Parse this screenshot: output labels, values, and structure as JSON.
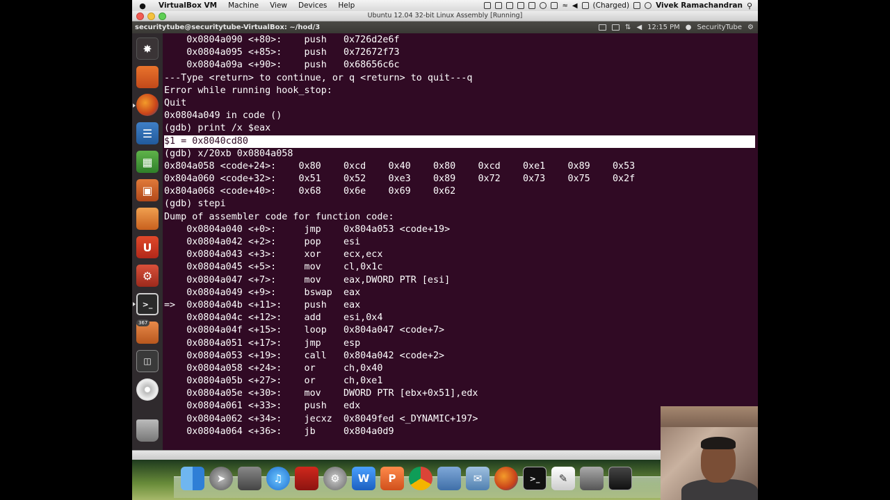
{
  "mac_menubar": {
    "apple": "",
    "app_name": "VirtualBox VM",
    "menus": [
      "Machine",
      "View",
      "Devices",
      "Help"
    ],
    "battery": "(Charged)",
    "user": "Vivek Ramachandran"
  },
  "vm_window": {
    "title": "Ubuntu 12.04 32-bit Linux Assembly [Running]"
  },
  "ubuntu_panel": {
    "window_title": "securitytube@securitytube-VirtualBox: ~/hod/3",
    "clock": "12:15 PM",
    "user": "SecurityTube"
  },
  "launcher": {
    "badge": "367"
  },
  "terminal": {
    "lines": [
      "    0x0804a090 <+80>:    push   0x726d2e6f",
      "    0x0804a095 <+85>:    push   0x72672f73",
      "    0x0804a09a <+90>:    push   0x68656c6c",
      "---Type <return> to continue, or q <return> to quit---q",
      "Error while running hook_stop:",
      "Quit",
      "0x0804a049 in code ()",
      "(gdb) print /x $eax",
      "$1 = 0x8040cd80",
      "(gdb) x/20xb 0x0804a058",
      "0x804a058 <code+24>:    0x80    0xcd    0x40    0x80    0xcd    0xe1    0x89    0x53",
      "0x804a060 <code+32>:    0x51    0x52    0xe3    0x89    0x72    0x73    0x75    0x2f",
      "0x804a068 <code+40>:    0x68    0x6e    0x69    0x62",
      "(gdb) stepi",
      "Dump of assembler code for function code:",
      "    0x0804a040 <+0>:     jmp    0x804a053 <code+19>",
      "    0x0804a042 <+2>:     pop    esi",
      "    0x0804a043 <+3>:     xor    ecx,ecx",
      "    0x0804a045 <+5>:     mov    cl,0x1c",
      "    0x0804a047 <+7>:     mov    eax,DWORD PTR [esi]",
      "    0x0804a049 <+9>:     bswap  eax",
      "=>  0x0804a04b <+11>:    push   eax",
      "    0x0804a04c <+12>:    add    esi,0x4",
      "    0x0804a04f <+15>:    loop   0x804a047 <code+7>",
      "    0x0804a051 <+17>:    jmp    esp",
      "    0x0804a053 <+19>:    call   0x804a042 <code+2>",
      "    0x0804a058 <+24>:    or     ch,0x40",
      "    0x0804a05b <+27>:    or     ch,0xe1",
      "    0x0804a05e <+30>:    mov    DWORD PTR [ebx+0x51],edx",
      "    0x0804a061 <+33>:    push   edx",
      "    0x0804a062 <+34>:    jecxz  0x8049fed <_DYNAMIC+197>",
      "    0x0804a064 <+36>:    jb     0x804a0d9"
    ],
    "highlighted_line": 8,
    "background": "#300a24"
  },
  "colors": {
    "terminal_bg": "#300a24",
    "terminal_fg": "#ffffff",
    "launcher_bg": "#2f2a2d",
    "panel_bg": "#3c3b37"
  },
  "icons": {
    "launcher": [
      "dash-icon",
      "files-icon",
      "firefox-icon",
      "writer-icon",
      "calc-icon",
      "impress-icon",
      "software-center-icon",
      "ubuntu-one-icon",
      "system-settings-icon",
      "terminal-icon",
      "update-manager-icon",
      "workspaces-icon",
      "cd-drive-icon",
      "trash-icon"
    ],
    "dock": [
      "finder-icon",
      "launchpad-icon",
      "preview-icon",
      "itunes-icon",
      "photo-booth-icon",
      "system-preferences-icon",
      "word-icon",
      "powerpoint-icon",
      "chrome-icon",
      "virtualbox-icon",
      "mail-icon",
      "firefox-icon",
      "terminal-icon",
      "textedit-icon",
      "photos-icon",
      "screen-icon"
    ]
  }
}
